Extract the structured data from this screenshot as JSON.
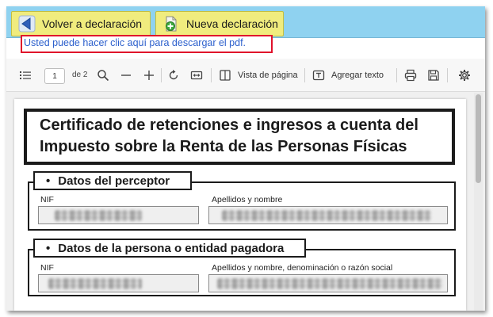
{
  "top_buttons": {
    "back_label": "Volver a declaración",
    "new_label": "Nueva declaración"
  },
  "pdf_link": "Usted puede hacer clic aquí para descargar el pdf.",
  "toolbar": {
    "page_value": "1",
    "page_of": "de 2",
    "page_view_label": "Vista de página",
    "add_text_label": "Agregar texto"
  },
  "document": {
    "title_line1": "Certificado de retenciones e ingresos a cuenta del",
    "title_line2": "Impuesto sobre la Renta de las Personas Físicas",
    "perceptor": {
      "heading": "Datos del perceptor",
      "nif_label": "NIF",
      "name_label": "Apellidos y nombre"
    },
    "pagadora": {
      "heading": "Datos de la persona o entidad pagadora",
      "nif_label": "NIF",
      "name_label": "Apellidos y nombre, denominación o razón social"
    }
  },
  "colors": {
    "banner": "#8fd2f0",
    "button_bg": "#f0ec7e",
    "link": "#2b5fcc",
    "link_box_border": "#e0112b"
  },
  "icons": [
    "back-arrow-icon",
    "new-document-icon",
    "contents-icon",
    "search-icon",
    "zoom-out-icon",
    "zoom-in-icon",
    "rotate-icon",
    "fit-page-icon",
    "page-view-icon",
    "add-text-icon",
    "print-icon",
    "save-icon",
    "settings-icon"
  ]
}
